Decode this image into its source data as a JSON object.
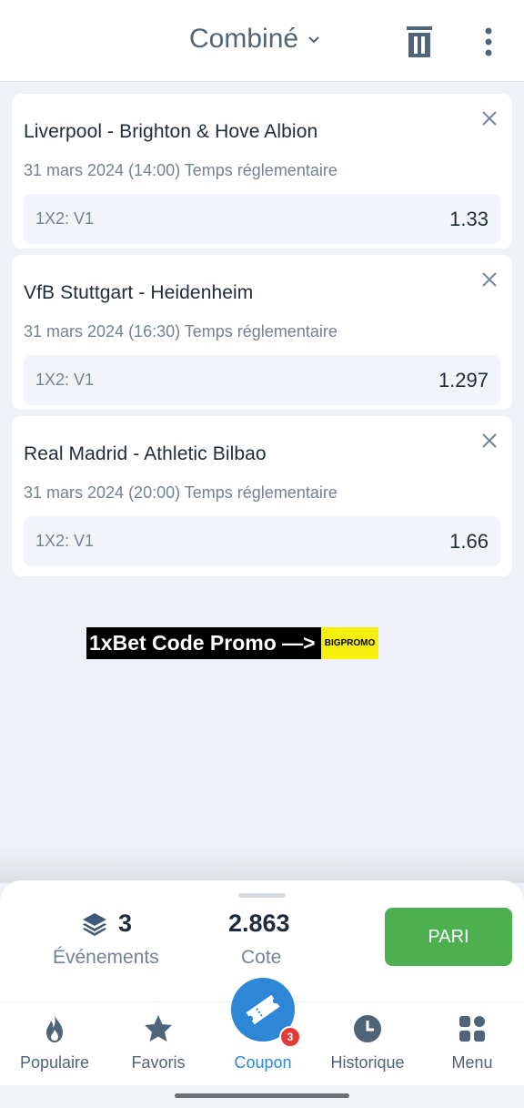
{
  "header": {
    "title": "Combiné",
    "icons": [
      "chevron-down-icon",
      "trash-icon",
      "more-vertical-icon"
    ]
  },
  "bets": [
    {
      "match": "Liverpool - Brighton & Hove Albion",
      "datetime": "31 mars 2024 (14:00) Temps réglementaire",
      "market": "1X2: V1",
      "odd": "1.33"
    },
    {
      "match": "VfB Stuttgart - Heidenheim",
      "datetime": "31 mars 2024 (16:30) Temps réglementaire",
      "market": "1X2: V1",
      "odd": "1.297"
    },
    {
      "match": "Real Madrid - Athletic Bilbao",
      "datetime": "31 mars 2024 (20:00) Temps réglementaire",
      "market": "1X2: V1",
      "odd": "1.66"
    }
  ],
  "promo": {
    "text": "1xBet Code Promo —>",
    "code": "BIGPROMO"
  },
  "summary": {
    "events_count": "3",
    "events_label": "Événements",
    "total_odds": "2.863",
    "odds_label": "Cote",
    "bet_button": "PARI"
  },
  "nav": {
    "items": [
      {
        "label": "Populaire",
        "icon": "fire-icon"
      },
      {
        "label": "Favoris",
        "icon": "star-icon"
      },
      {
        "label": "Coupon",
        "icon": "ticket-icon"
      },
      {
        "label": "Historique",
        "icon": "clock-icon"
      },
      {
        "label": "Menu",
        "icon": "grid-icon"
      }
    ],
    "coupon_badge": "3"
  },
  "colors": {
    "accent": "#2d86d6",
    "bet_button": "#4caf50",
    "badge": "#e53935",
    "background": "#eef1f5"
  }
}
